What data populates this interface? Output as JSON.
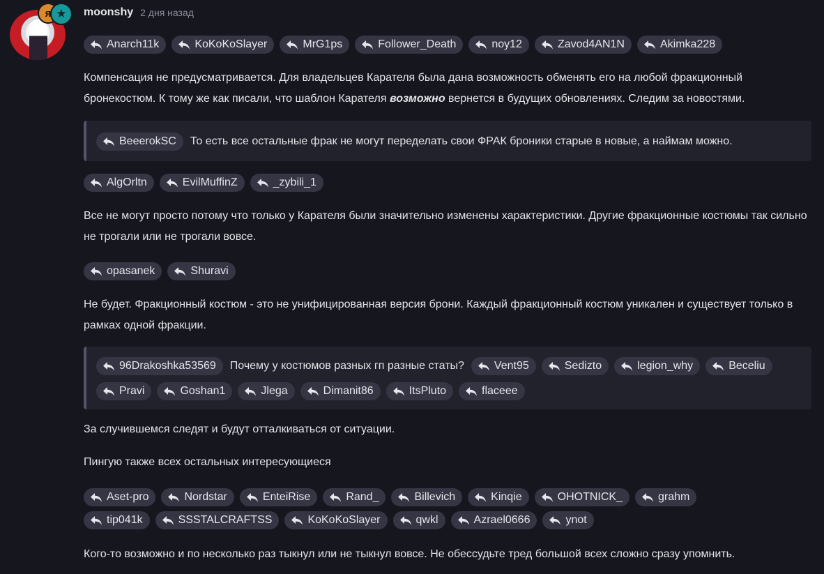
{
  "post": {
    "author": "moonshy",
    "timestamp": "2 дня назад",
    "avatar_badges": [
      "я",
      "★"
    ]
  },
  "mentions_1": [
    "Anarch11k",
    "KoKoKoSlayer",
    "MrG1ps",
    "Follower_Death",
    "noy12",
    "Zavod4AN1N",
    "Akimka228"
  ],
  "paragraph_1": {
    "before": "Компенсация не предусматривается. Для владельцев Карателя была дана возможность обменять его на любой фракционный бронекостюм. К тому же как писали, что шаблон Карателя ",
    "emph": "возможно",
    "after": " вернется в будущих обновлениях. Следим за новостями."
  },
  "quote_1": {
    "mention": "BeeerokSC",
    "text": "То есть все остальные фрак не могут переделать свои ФРАК броники старые в новые, а наймам можно."
  },
  "mentions_2": [
    "AlgOrltn",
    "EvilMuffinZ",
    "_zybili_1"
  ],
  "paragraph_2": "Все не могут просто потому что только у Карателя были значительно изменены характеристики. Другие фракционные костюмы так сильно не трогали или не трогали вовсе.",
  "mentions_3": [
    "opasanek",
    "Shuravi"
  ],
  "paragraph_3": "Не будет. Фракционный костюм - это не унифицированная версия брони. Каждый фракционный костюм уникален и существует только в рамках одной фракции.",
  "quote_2": {
    "mention": "96Drakoshka53569",
    "text": "Почему у костюмов разных гп разные статы?",
    "mentions": [
      "Vent95",
      "Sedizto",
      "legion_why",
      "Beceliu",
      "Pravi",
      "Goshan1",
      "Jlega",
      "Dimanit86",
      "ItsPluto",
      "flaceee"
    ]
  },
  "paragraph_4": "За случившемся следят и будут отталкиваться от ситуации.",
  "paragraph_5": "Пингую также всех остальных интересующиеся",
  "mentions_4": [
    "Aset-pro",
    "Nordstar",
    "EnteiRise",
    "Rand_",
    "Billevich",
    "Kinqie",
    "OHOTNICK_",
    "grahm",
    "tip041k",
    "SSSTALCRAFTSS",
    "KoKoKoSlayer",
    "qwkl",
    "Azrael0666",
    "ynot"
  ],
  "paragraph_6": "Кого-то возможно и по несколько раз тыкнул или не тыкнул вовсе. Не обессудьте тред большой всех сложно сразу упомнить.",
  "colors": {
    "background": "#16161f",
    "chip": "#353544",
    "quote_bg": "#22222d",
    "quote_border": "#55556a"
  }
}
